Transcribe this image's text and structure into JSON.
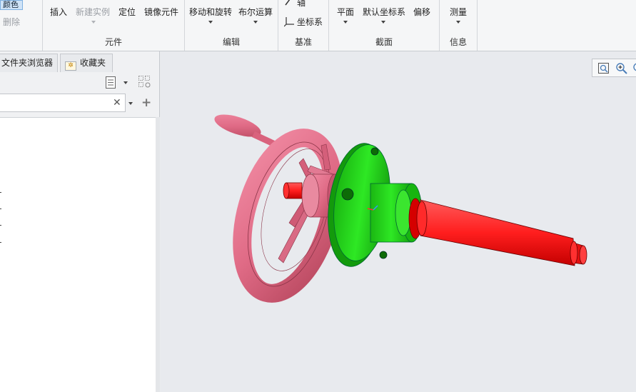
{
  "ribbon": {
    "color_btn": "颜色",
    "delete_btn": "删除",
    "components": {
      "insert": "插入",
      "new_instance": "新建实例",
      "locate": "定位",
      "mirror_component": "镜像元件",
      "label": "元件"
    },
    "edit": {
      "move_rotate": "移动和旋转",
      "boolean_ops": "布尔运算",
      "label": "编辑"
    },
    "datum": {
      "axis": "轴",
      "csys": "坐标系",
      "label": "基准"
    },
    "section": {
      "plane": "平面",
      "default_csys": "默认坐标系",
      "offset": "偏移",
      "label": "截面"
    },
    "info": {
      "measure": "测量",
      "label": "信息"
    }
  },
  "left_panel": {
    "tabs": [
      {
        "label": "文件夹浏览器"
      },
      {
        "label": "收藏夹"
      }
    ],
    "search": {
      "value": "",
      "placeholder": ""
    }
  },
  "colors": {
    "handwheel": "#e0708a",
    "flange": "#22dd18",
    "shaft": "#ff1e1e",
    "background": "#e8eaee"
  },
  "icons": [
    "search-icon",
    "zoom-in-icon",
    "clear-icon",
    "add-icon",
    "tree-list-icon",
    "tree-settings-icon",
    "favorites-icon"
  ]
}
